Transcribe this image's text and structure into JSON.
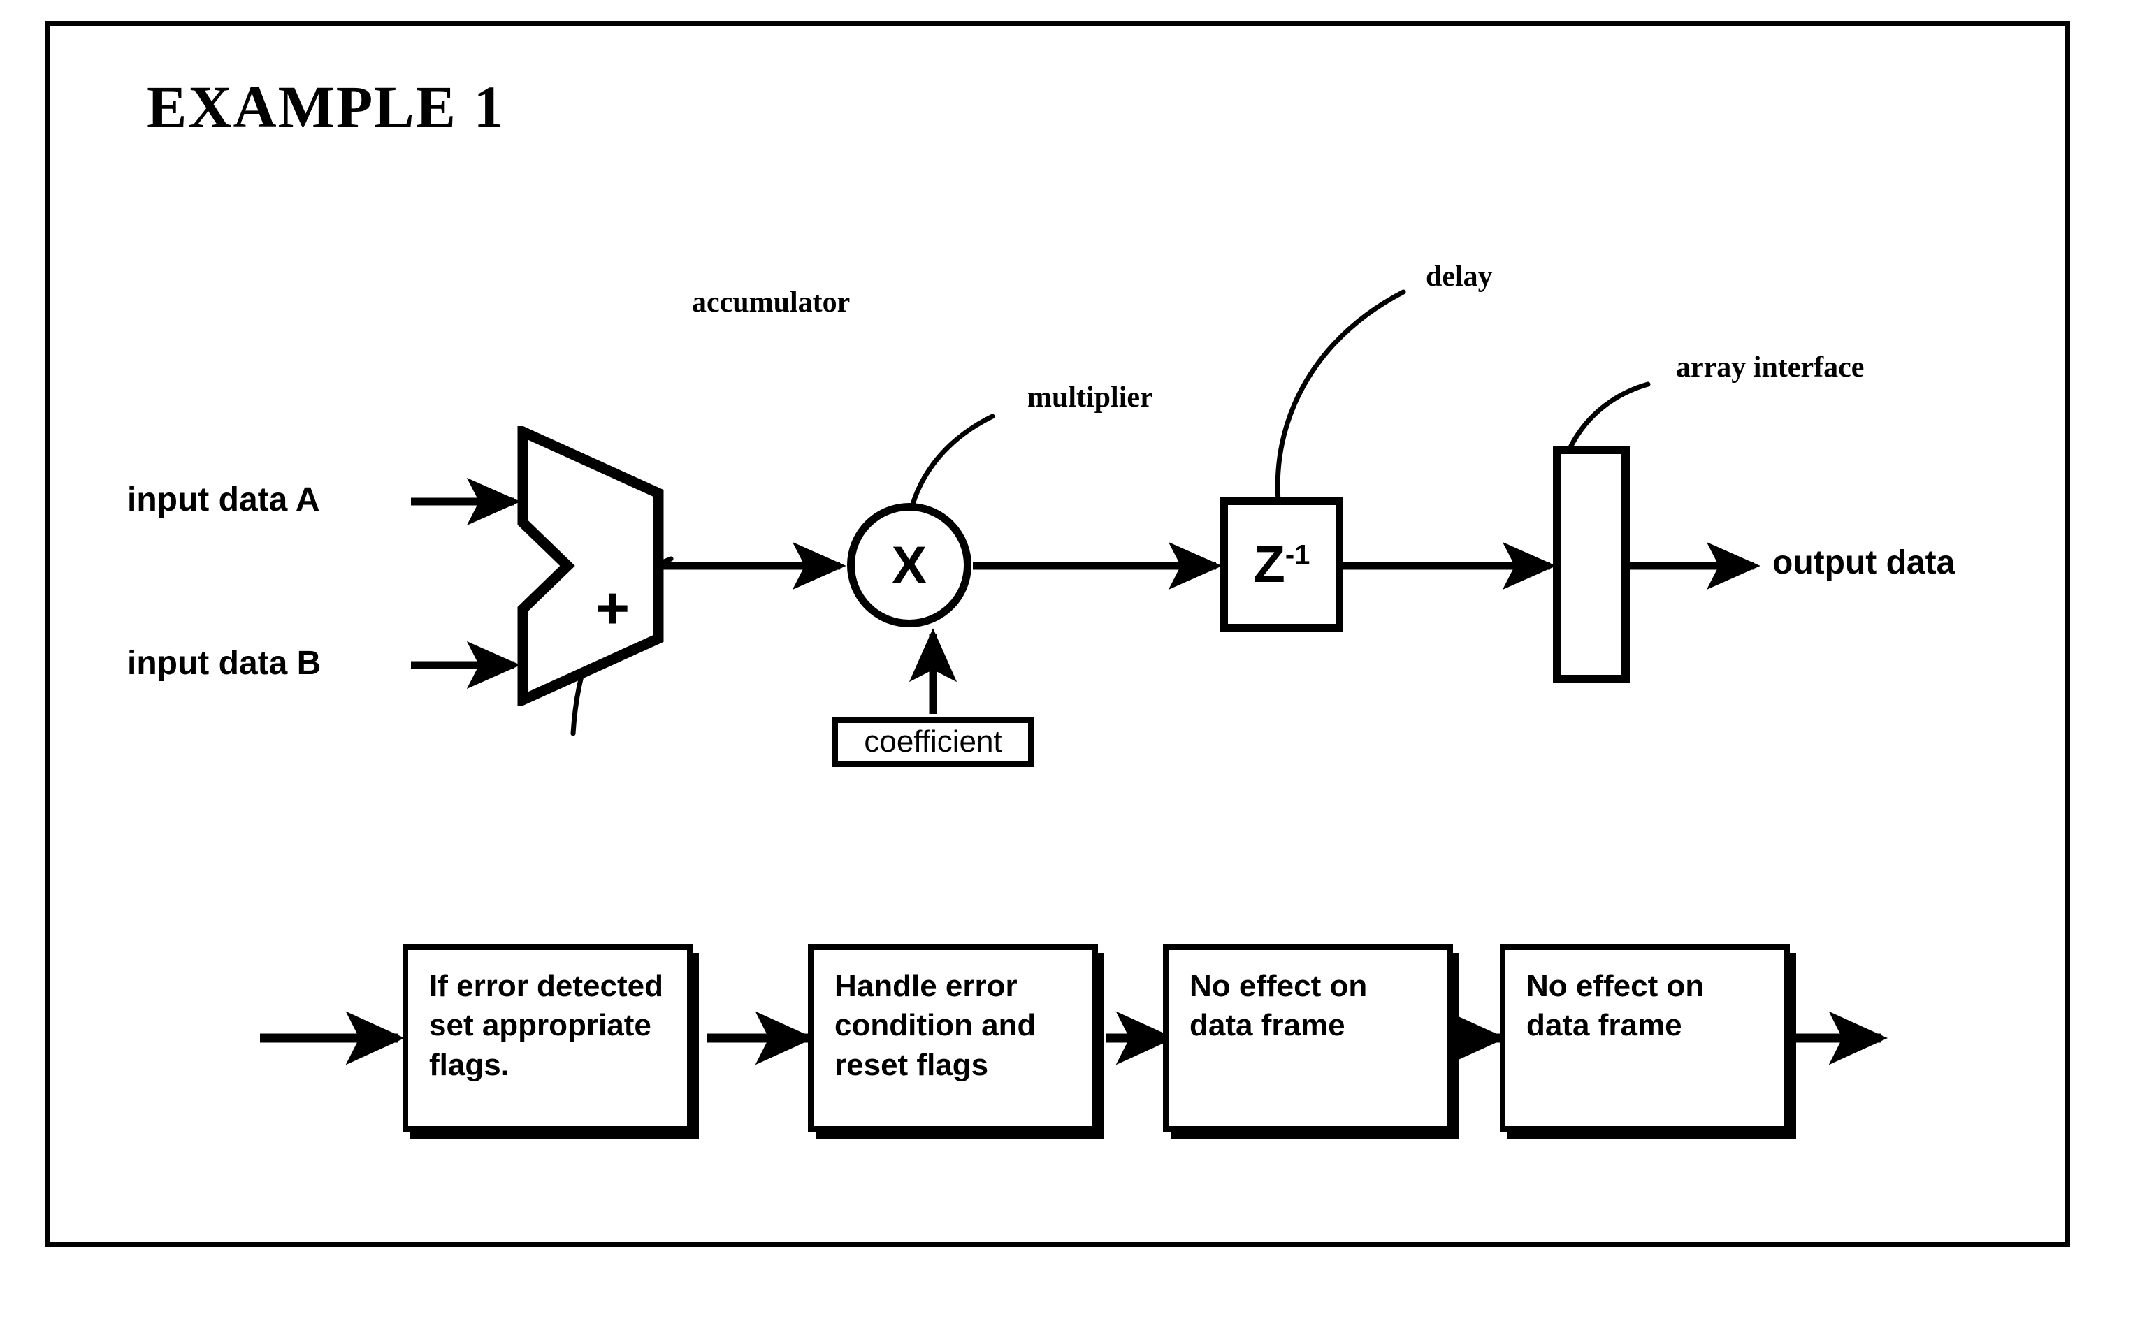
{
  "page": {
    "title": "EXAMPLE 1",
    "background_color": "#ffffff",
    "ink_color": "#000000"
  },
  "datapath": {
    "inputs": [
      {
        "label": "input data A"
      },
      {
        "label": "input data B"
      }
    ],
    "output": {
      "label": "output data"
    },
    "blocks": [
      {
        "id": "accumulator",
        "callout": "accumulator",
        "glyph": "+",
        "shape": "adder-trapezoid"
      },
      {
        "id": "multiplier",
        "callout": "multiplier",
        "glyph": "X",
        "shape": "circle"
      },
      {
        "id": "delay",
        "callout": "delay",
        "glyph_base": "Z",
        "glyph_exponent": "-1",
        "shape": "square"
      },
      {
        "id": "array-interface",
        "callout": "array interface",
        "glyph": "",
        "shape": "tall-rectangle"
      }
    ],
    "coefficient": {
      "label": "coefficient"
    }
  },
  "flowchart": {
    "steps": [
      {
        "text": "If error detected\nset appropriate\nflags."
      },
      {
        "text": "Handle error\ncondition and\nreset flags"
      },
      {
        "text": "No effect on\ndata frame"
      },
      {
        "text": "No effect on\ndata frame"
      }
    ]
  },
  "chart_data": {
    "type": "diagram",
    "title": "EXAMPLE 1",
    "subtype": "signal-processing datapath + error-handling flowchart",
    "nodes": [
      {
        "id": "input-a",
        "label": "input data A",
        "kind": "signal-label"
      },
      {
        "id": "input-b",
        "label": "input data B",
        "kind": "signal-label"
      },
      {
        "id": "accumulator",
        "label": "+",
        "callout": "accumulator",
        "kind": "adder"
      },
      {
        "id": "multiplier",
        "label": "X",
        "callout": "multiplier",
        "kind": "multiplier"
      },
      {
        "id": "coefficient",
        "label": "coefficient",
        "kind": "constant-box"
      },
      {
        "id": "delay",
        "label": "Z-1",
        "callout": "delay",
        "kind": "delay-element"
      },
      {
        "id": "array-interface",
        "label": "",
        "callout": "array interface",
        "kind": "interface-block"
      },
      {
        "id": "output",
        "label": "output data",
        "kind": "signal-label"
      },
      {
        "id": "step-1",
        "label": "If error detected set appropriate flags.",
        "kind": "process"
      },
      {
        "id": "step-2",
        "label": "Handle error condition and reset flags",
        "kind": "process"
      },
      {
        "id": "step-3",
        "label": "No effect on data frame",
        "kind": "process"
      },
      {
        "id": "step-4",
        "label": "No effect on data frame",
        "kind": "process"
      }
    ],
    "edges": [
      {
        "from": "input-a",
        "to": "accumulator",
        "arrow": true
      },
      {
        "from": "input-b",
        "to": "accumulator",
        "arrow": true
      },
      {
        "from": "accumulator",
        "to": "multiplier",
        "arrow": true
      },
      {
        "from": "coefficient",
        "to": "multiplier",
        "arrow": true
      },
      {
        "from": "multiplier",
        "to": "delay",
        "arrow": true
      },
      {
        "from": "delay",
        "to": "array-interface",
        "arrow": true
      },
      {
        "from": "array-interface",
        "to": "output",
        "arrow": true
      },
      {
        "from": "flow-in",
        "to": "step-1",
        "arrow": true
      },
      {
        "from": "step-1",
        "to": "step-2",
        "arrow": true
      },
      {
        "from": "step-2",
        "to": "step-3",
        "arrow": true
      },
      {
        "from": "step-3",
        "to": "step-4",
        "arrow": true
      },
      {
        "from": "step-4",
        "to": "flow-out",
        "arrow": true
      }
    ]
  }
}
